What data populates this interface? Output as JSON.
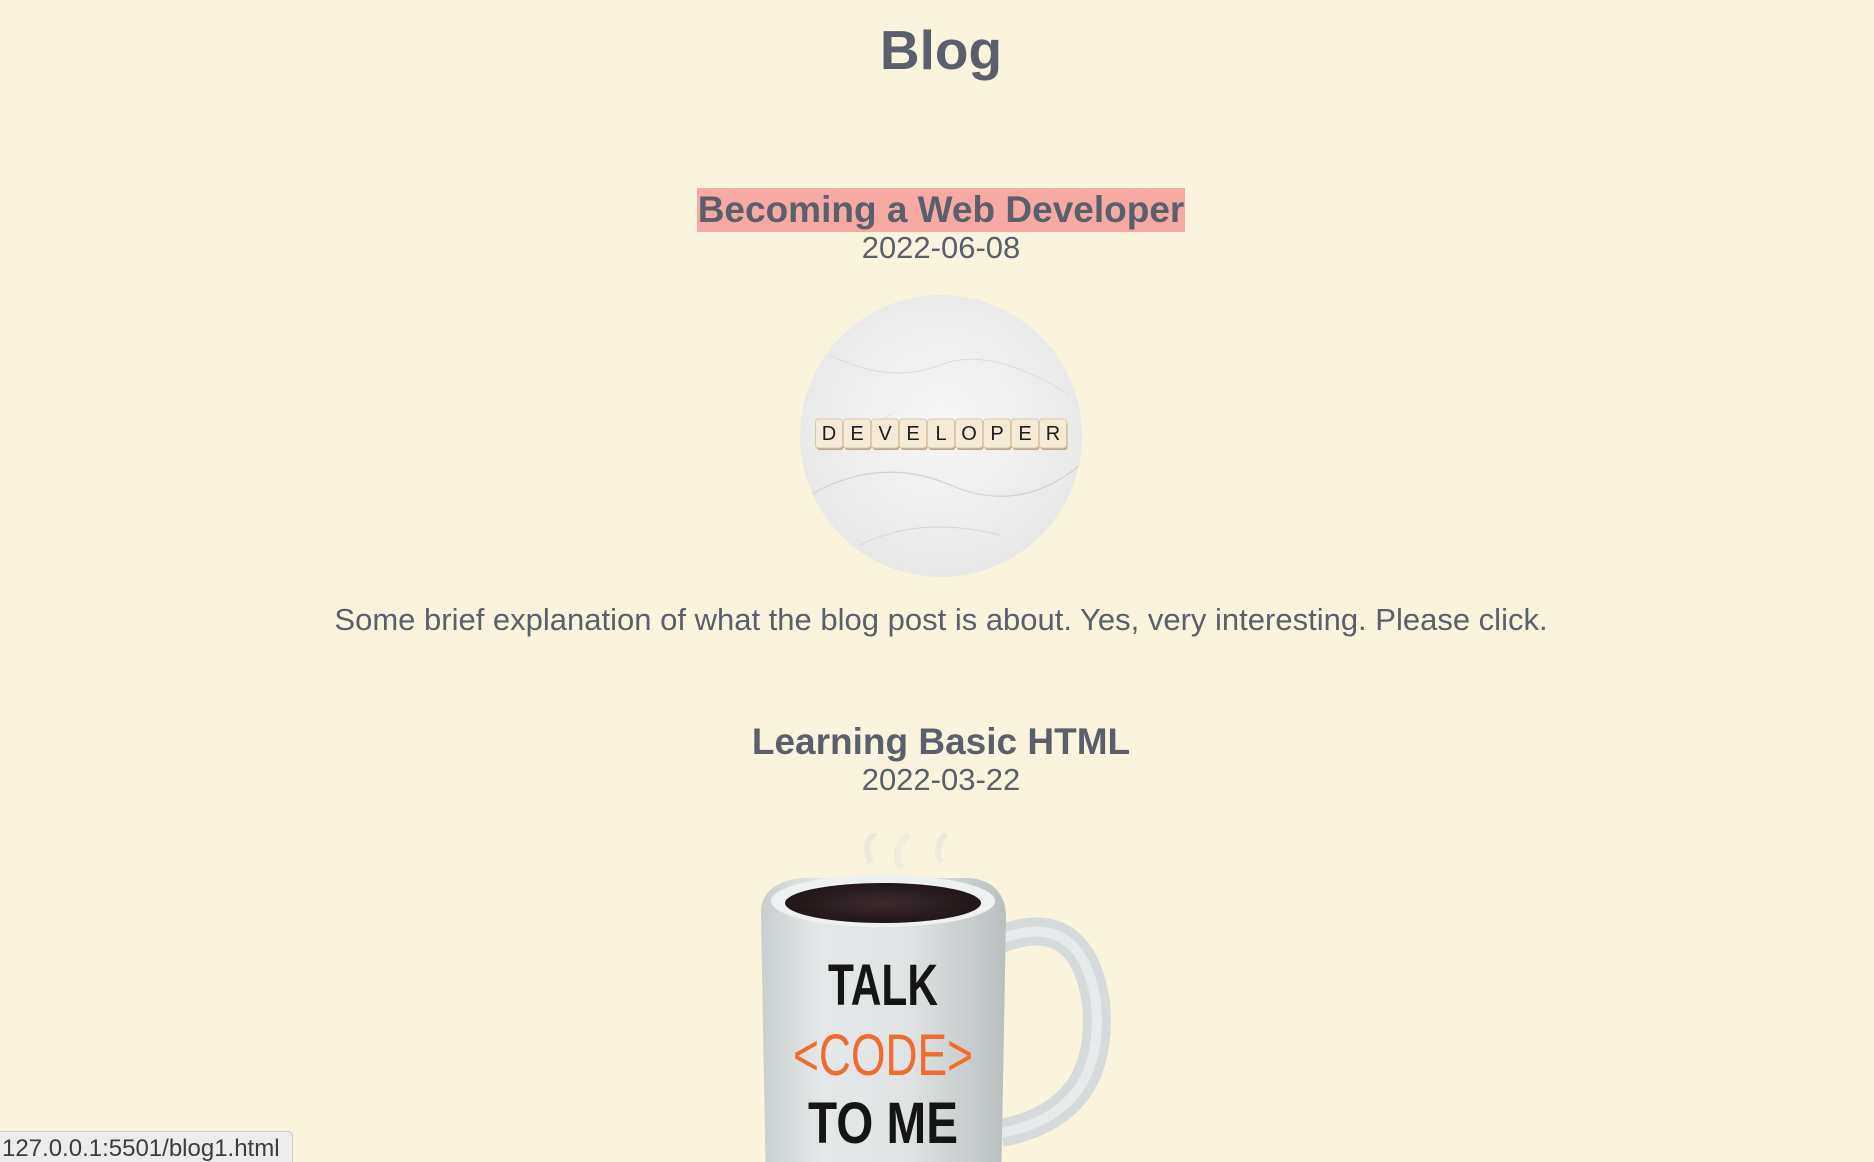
{
  "page": {
    "title": "Blog"
  },
  "posts": [
    {
      "title": "Becoming a Web Developer",
      "date": "2022-06-08",
      "image_icon": "scrabble-tiles-developer-image",
      "image_tiles": [
        "D",
        "E",
        "V",
        "E",
        "L",
        "O",
        "P",
        "E",
        "R"
      ],
      "excerpt": "Some brief explanation of what the blog post is about. Yes, very interesting. Please click."
    },
    {
      "title": "Learning Basic HTML",
      "date": "2022-03-22",
      "image_icon": "coffee-mug-image",
      "mug_text": {
        "line1": "TALK",
        "line2": "<CODE>",
        "line3": "TO ME"
      }
    }
  ],
  "status_bar": {
    "url": "127.0.0.1:5501/blog1.html"
  },
  "colors": {
    "background": "#faf3dd",
    "text": "#5a5f6c",
    "hover_highlight": "#f7a9a3",
    "code_accent": "#f26a2c"
  }
}
